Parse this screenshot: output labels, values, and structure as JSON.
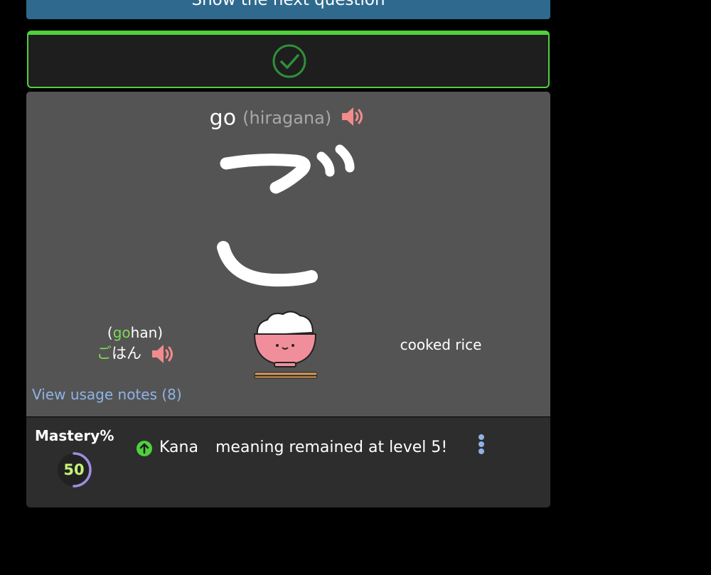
{
  "next_button": {
    "label": "Show the next question"
  },
  "result": {
    "status": "correct",
    "icon": "check-circle-icon",
    "accent": "#4fd13d"
  },
  "kana_card": {
    "romaji": "go",
    "script_label": "(hiragana)",
    "kana": "ご",
    "audio_icon": "speaker-icon",
    "audio_color": "#f28b8b"
  },
  "vocab": {
    "reading_open": "(",
    "reading_highlight": "go",
    "reading_rest": "han)",
    "kana_highlight": "ご",
    "kana_rest": "はん",
    "meaning": "cooked rice",
    "image_icon": "rice-bowl-icon"
  },
  "usage_notes": {
    "label": "View usage notes (8)"
  },
  "mastery": {
    "label": "Mastery%",
    "value": "50",
    "percent": 50,
    "ring_color": "#9b8fe0",
    "type_label": "Kana",
    "message": "meaning remained at level 5!",
    "icon": "arrow-up-circle-icon",
    "icon_color": "#4fd13d"
  },
  "menu": {
    "icon": "more-vertical-icon",
    "color": "#8fb3e6"
  }
}
